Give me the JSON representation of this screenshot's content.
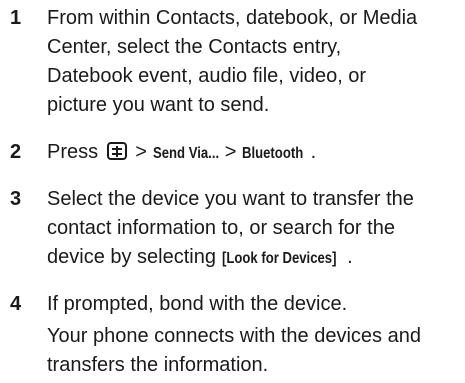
{
  "steps": [
    {
      "number": "1",
      "lines": [
        "From within Contacts, datebook, or Media",
        "Center, select the Contacts entry,",
        "Datebook event, audio file, video, or",
        "picture you want to send."
      ]
    },
    {
      "number": "2",
      "press": "Press",
      "menu_icon": "menu-key-icon",
      "sep1": ">",
      "send_via": "Send Via...",
      "sep2": ">",
      "bluetooth": "Bluetooth",
      "end": "."
    },
    {
      "number": "3",
      "lines": [
        "Select the device you want to transfer the",
        "contact information to, or search for the"
      ],
      "line3_prefix": "device by selecting",
      "look_for_devices": "[Look for Devices]",
      "line3_suffix": "."
    },
    {
      "number": "4",
      "text": "If prompted, bond with the device."
    }
  ],
  "note": {
    "lines": [
      "Your phone connects with the devices and",
      "transfers the information."
    ]
  }
}
